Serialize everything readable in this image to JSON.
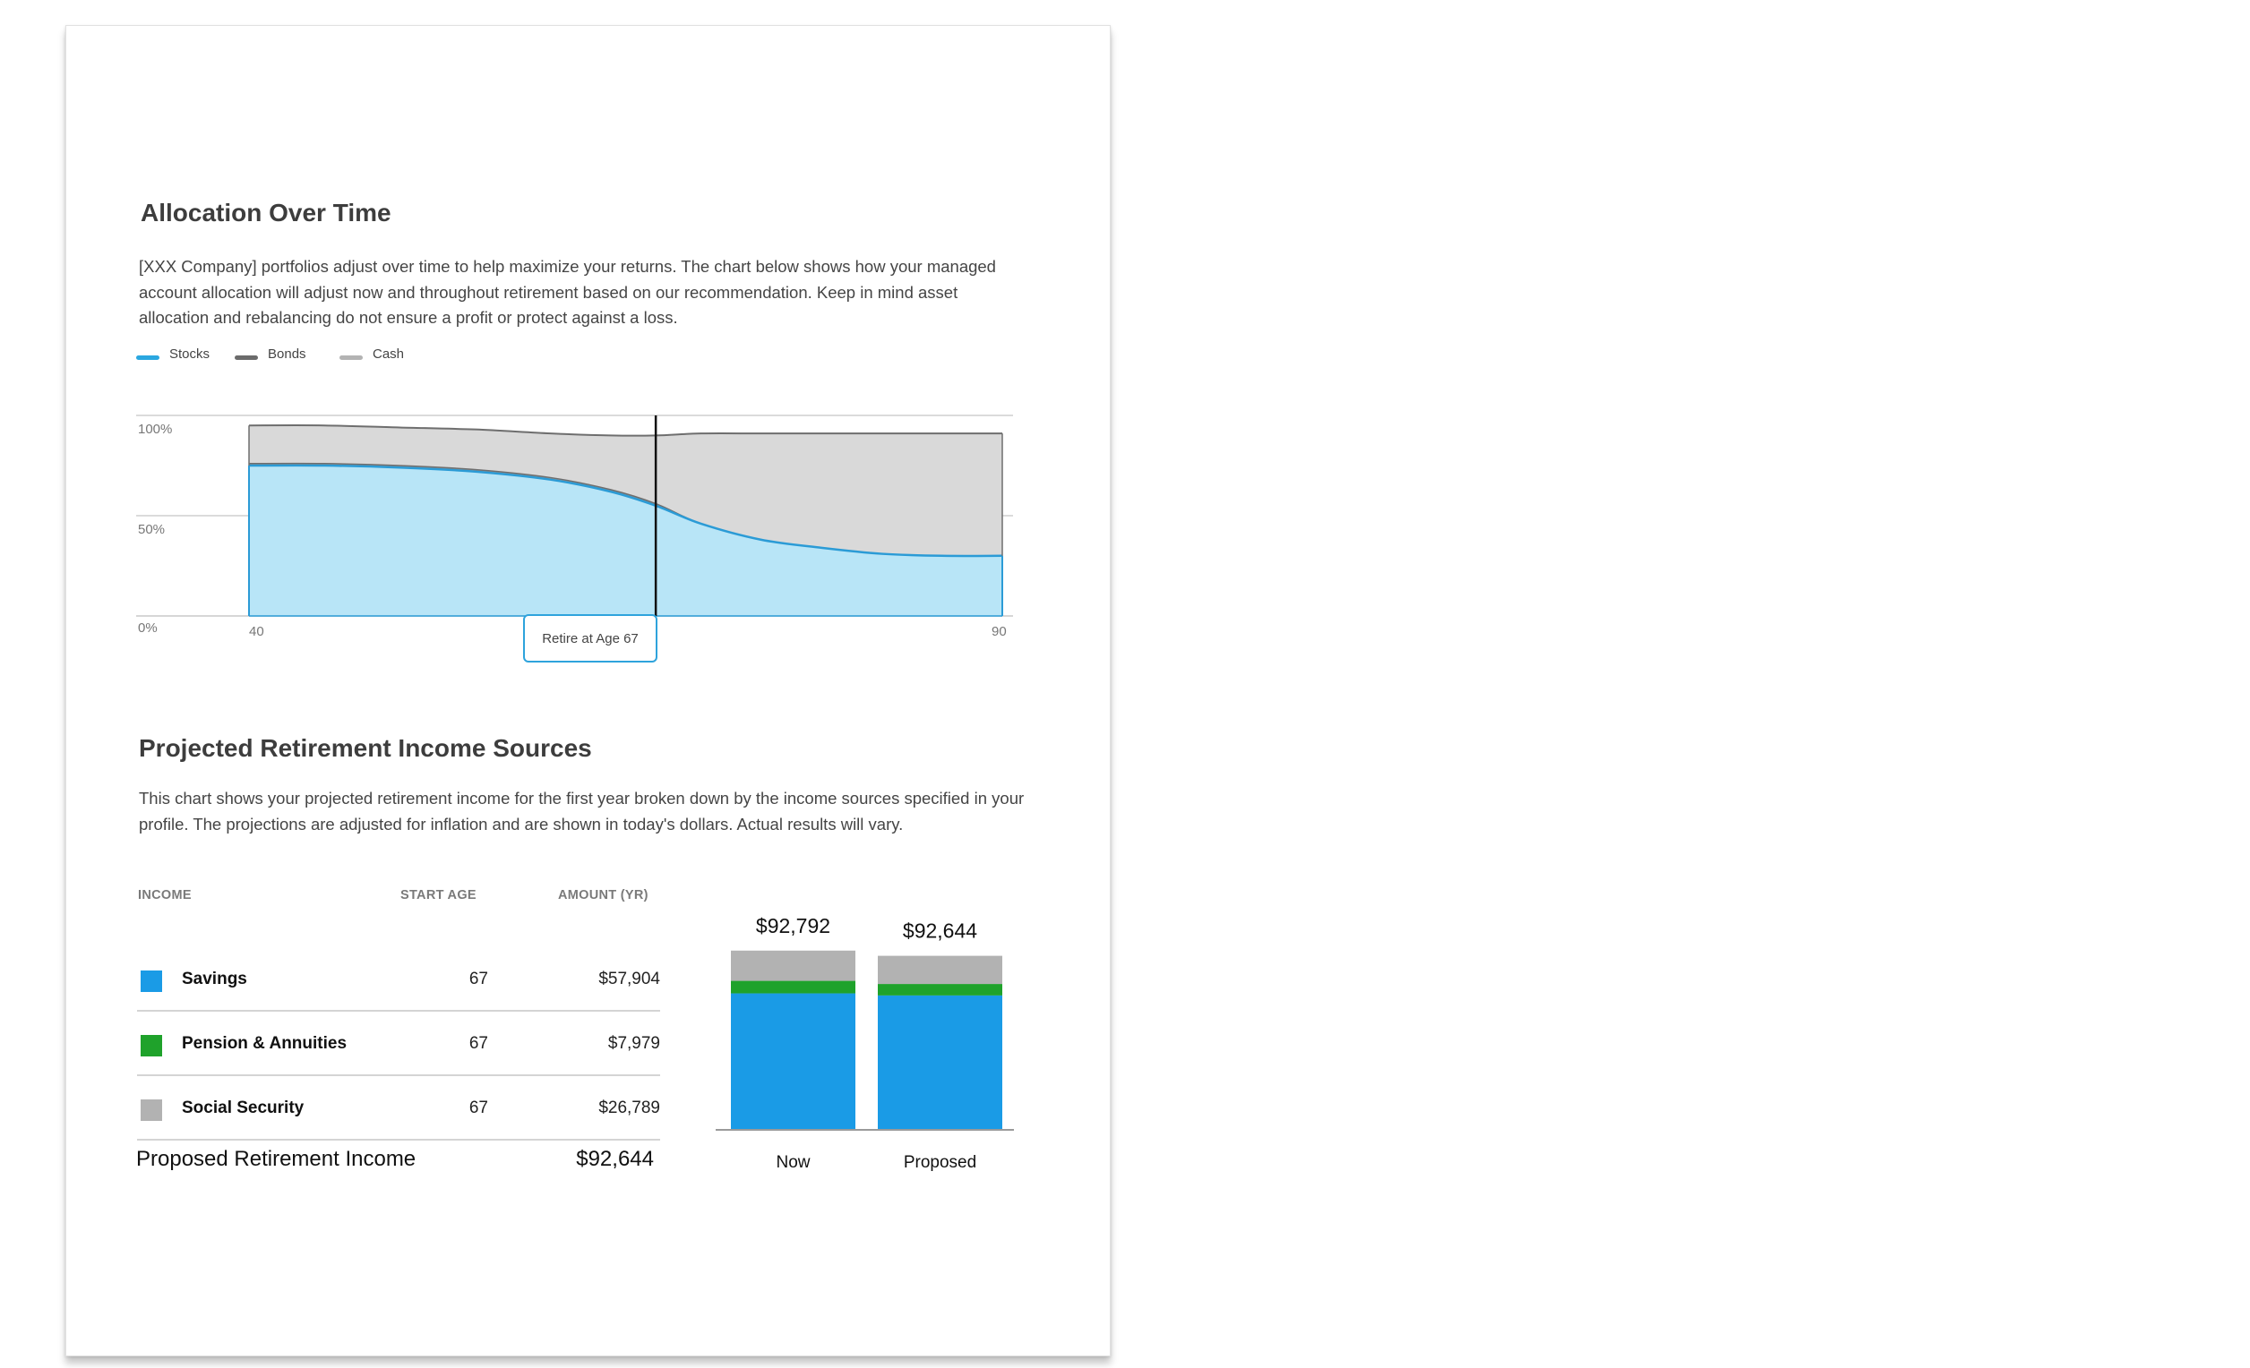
{
  "allocation": {
    "title": "Allocation Over Time",
    "description": "[XXX Company] portfolios adjust over time to help maximize your returns. The chart below shows how your managed account allocation will adjust now and throughout retirement based on our recommendation. Keep in mind asset allocation and rebalancing do not ensure a profit or protect against a loss.",
    "retire_label": "Retire at Age 67"
  },
  "income": {
    "title": "Projected Retirement Income Sources",
    "description": "This chart shows your projected retirement income for the first year broken down by the income sources specified in your profile. The projections are adjusted for inflation and are shown in today's dollars. Actual results will vary.",
    "columns": {
      "income": "INCOME",
      "start_age": "START AGE",
      "amount": "AMOUNT (YR)"
    },
    "rows": [
      {
        "name": "Savings",
        "start_age": "67",
        "amount": "$57,904",
        "color": "#1a9be6"
      },
      {
        "name": "Pension & Annuities",
        "start_age": "67",
        "amount": "$7,979",
        "color": "#1fa22b"
      },
      {
        "name": "Social Security",
        "start_age": "67",
        "amount": "$26,789",
        "color": "#b2b2b2"
      }
    ],
    "total_label": "Proposed Retirement Income",
    "total_amount": "$92,644"
  },
  "chart_data": [
    {
      "type": "area",
      "legend": [
        "Stocks",
        "Bonds",
        "Cash"
      ],
      "colors": {
        "Stocks": "#2aa7e0",
        "Bonds": "#6b6b6b",
        "Cash": "#b3b3b3"
      },
      "x_range": [
        40,
        90
      ],
      "x_ticks": [
        "40",
        "90"
      ],
      "y_ticks": [
        "100%",
        "50%",
        "0%"
      ],
      "ylim": [
        0,
        100
      ],
      "retire_age": 67,
      "series": [
        {
          "name": "Stocks",
          "x": [
            40,
            45,
            50,
            55,
            60,
            64,
            67,
            70,
            74,
            78,
            82,
            86,
            90
          ],
          "values": [
            75,
            75,
            74,
            72,
            68,
            62,
            55,
            46,
            38,
            34,
            31,
            30,
            30
          ]
        },
        {
          "name": "Bonds",
          "x": [
            40,
            45,
            50,
            55,
            60,
            64,
            67,
            70,
            74,
            78,
            82,
            86,
            90
          ],
          "values": [
            1,
            1,
            1,
            1,
            1,
            1,
            1,
            0,
            0,
            0,
            0,
            0,
            0
          ]
        },
        {
          "name": "Cash",
          "x": [
            40,
            45,
            50,
            55,
            60,
            64,
            67,
            70,
            74,
            78,
            82,
            86,
            90
          ],
          "values": [
            19,
            19,
            19,
            20,
            22,
            27,
            34,
            45,
            53,
            57,
            60,
            61,
            61
          ]
        }
      ]
    },
    {
      "type": "bar",
      "stacked": true,
      "categories": [
        "Now",
        "Proposed"
      ],
      "totals": [
        "$92,792",
        "$92,644"
      ],
      "series": [
        {
          "name": "Savings",
          "color": "#1a9be6",
          "values": [
            65000,
            64000
          ]
        },
        {
          "name": "Pension & Annuities",
          "color": "#1fa22b",
          "values": [
            6000,
            5500
          ]
        },
        {
          "name": "Social Security",
          "color": "#b2b2b2",
          "values": [
            14500,
            13500
          ]
        }
      ]
    }
  ]
}
